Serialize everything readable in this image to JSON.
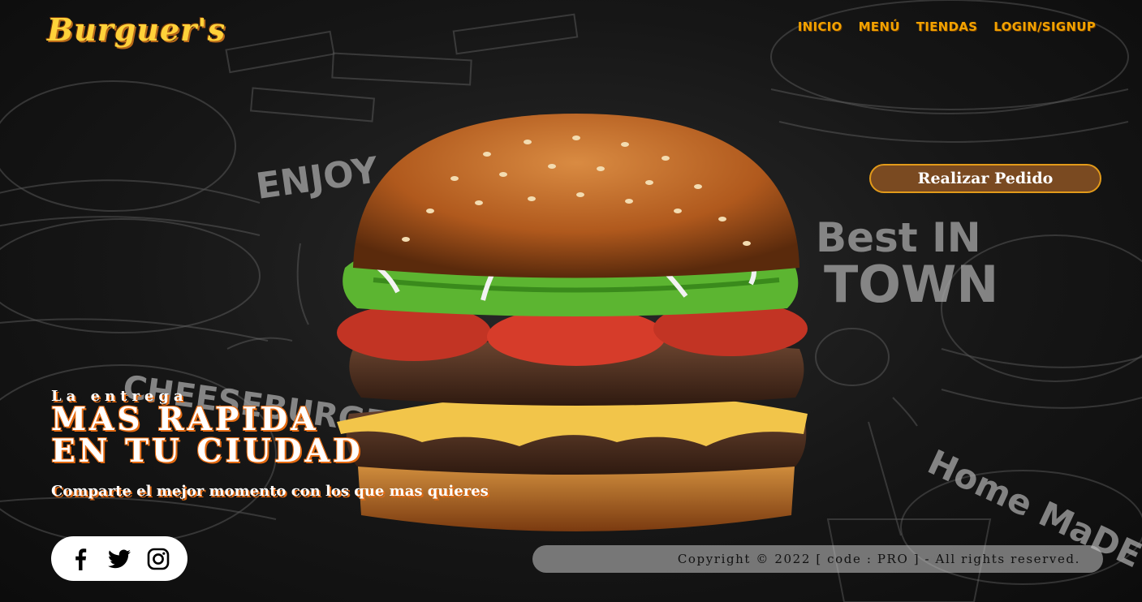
{
  "brand": {
    "logo": "Burguer's"
  },
  "nav": {
    "items": [
      "INICIO",
      "MENÚ",
      "TIENDAS",
      "LOGIN/SIGNUP"
    ]
  },
  "cta": {
    "order_label": "Realizar Pedido"
  },
  "hero": {
    "line1": "La entrega",
    "line2": "MAS RAPIDA",
    "line3": "EN TU CIUDAD",
    "subtitle": "Comparte el mejor momento con los que mas quieres"
  },
  "background_text": [
    "ENJOY",
    "Best IN",
    "TOWN",
    "CHEESEBURGER",
    "Home MaDE"
  ],
  "social": {
    "icons": [
      "facebook-icon",
      "twitter-icon",
      "instagram-icon"
    ]
  },
  "footer": {
    "copyright": "Copyright © 2022 [ code : PRO ] - All rights reserved."
  },
  "colors": {
    "accent": "#f2a200",
    "logo": "#ffd23a",
    "outline": "#e56b12",
    "button_bg": "#7a4a21"
  }
}
